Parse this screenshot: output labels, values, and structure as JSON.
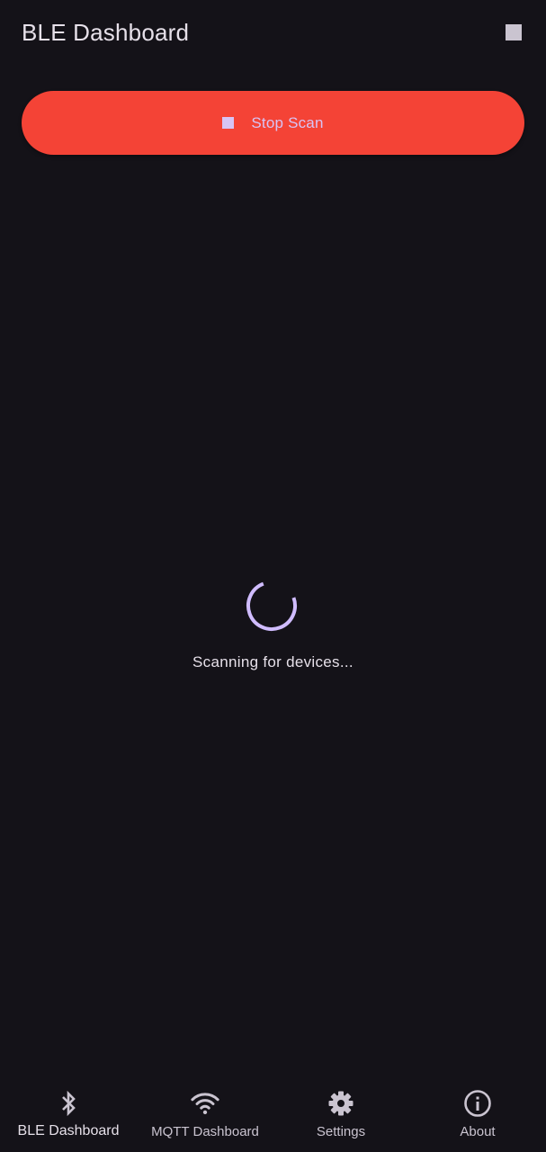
{
  "app_bar": {
    "title": "BLE Dashboard",
    "action_icon": "stop-icon"
  },
  "scan_button": {
    "icon": "stop-icon",
    "label": "Stop Scan",
    "color": "#f44336"
  },
  "status": {
    "text": "Scanning for devices...",
    "spinner_color": "#d0bcff"
  },
  "bottom_nav": {
    "items": [
      {
        "label": "BLE Dashboard",
        "icon": "bluetooth-icon",
        "active": true
      },
      {
        "label": "MQTT Dashboard",
        "icon": "wifi-icon",
        "active": false
      },
      {
        "label": "Settings",
        "icon": "gear-icon",
        "active": false
      },
      {
        "label": "About",
        "icon": "info-icon",
        "active": false
      }
    ]
  },
  "colors": {
    "background": "#141218",
    "on_surface": "#e6e0e9",
    "on_surface_variant": "#cac4d0",
    "primary": "#d0bcff"
  }
}
